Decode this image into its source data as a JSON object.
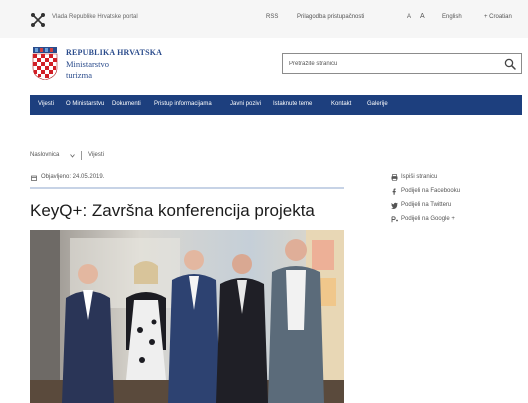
{
  "topbar": {
    "gov_label": "Vlada Republike Hrvatske portal",
    "links": [
      "RSS",
      "Prilagodba pristupačnosti",
      "A",
      "A",
      "English",
      "+ Croatian"
    ]
  },
  "header": {
    "brand_line1": "REPUBLIKA HRVATSKA",
    "brand_line2": "Ministarstvo",
    "brand_line3": "turizma",
    "search_placeholder": "Pretražite stranicu"
  },
  "nav": {
    "items": [
      "Vijesti",
      "O Ministarstvu",
      "Dokumenti",
      "Pristup informacijama",
      "Javni pozivi",
      "Istaknute teme",
      "Kontakt",
      "Galerije"
    ]
  },
  "breadcrumb": {
    "items": [
      "Naslovnica",
      "Vijesti"
    ]
  },
  "article": {
    "date": "Objavljeno: 24.05.2019.",
    "title": "KeyQ+: Završna konferencija projekta"
  },
  "sidebar": {
    "items": [
      "Ispiši stranicu",
      "Podijeli na Facebooku",
      "Podijeli na Twitteru",
      "Podijeli na Google +"
    ]
  },
  "colors": {
    "nav_bg": "#1d3f7e",
    "brand": "#2b4c8c"
  }
}
